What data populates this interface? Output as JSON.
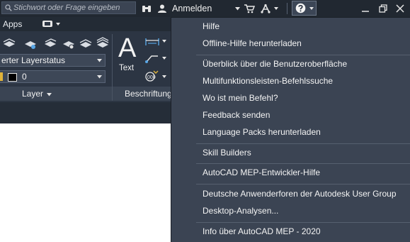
{
  "titlebar": {
    "search_placeholder": "Stichwort oder Frage eingeben",
    "sign_in_label": "Anmelden"
  },
  "ribbon": {
    "apps_tab": "Apps",
    "layer_state_value": "erter Layerstatus",
    "layer_value": "0",
    "text_glyph": "A",
    "text_button_label": "Text",
    "layer_panel_label": "Layer",
    "annotation_panel_label": "Beschriftung"
  },
  "help_menu": {
    "items": [
      "Hilfe",
      "Offline-Hilfe herunterladen",
      "Überblick über die Benutzeroberfläche",
      "Multifunktionsleisten-Befehlssuche",
      "Wo ist mein Befehl?",
      "Feedback senden",
      "Language Packs herunterladen",
      "Skill Builders",
      "AutoCAD MEP-Entwickler-Hilfe",
      "Deutsche Anwenderforen der Autodesk User Group",
      "Desktop-Analysen...",
      "Info über AutoCAD MEP - 2020"
    ]
  },
  "colors": {
    "titlebar_bg": "#212831",
    "ribbon_bg": "#2c3543",
    "menu_bg": "#3b4453",
    "accent_blue": "#2e7fd1"
  },
  "icons": {
    "search": "search-icon",
    "binoculars": "binoculars-icon",
    "user": "user-icon",
    "cart": "cart-icon",
    "autodesk_a360": "a360-icon",
    "help": "help-icon",
    "minimize": "minimize-icon",
    "restore": "restore-icon",
    "close": "close-icon"
  }
}
